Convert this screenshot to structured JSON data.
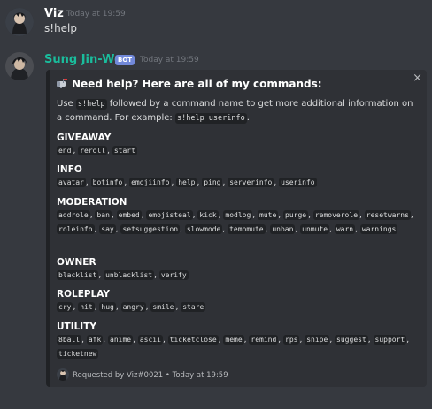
{
  "messages": [
    {
      "author": "Viz",
      "timestamp": "Today at 19:59",
      "content": "s!help"
    },
    {
      "author": "Sung Jin-Woo",
      "author_color": "#1abc9c",
      "bot_tag": "BOT",
      "timestamp": "Today at 19:59"
    }
  ],
  "embed": {
    "close_icon": "×",
    "title": "Need help? Here are all of my commands:",
    "desc_prefix": "Use",
    "desc_code": "s!help",
    "desc_middle": "followed by a command name to get more additional information on a command. For example:",
    "desc_example": "s!help userinfo",
    "desc_suffix": ".",
    "fields": [
      {
        "name": "GIVEAWAY",
        "commands": [
          "end",
          "reroll",
          "start"
        ]
      },
      {
        "name": "INFO",
        "commands": [
          "avatar",
          "botinfo",
          "emojiinfo",
          "help",
          "ping",
          "serverinfo",
          "userinfo"
        ]
      },
      {
        "name": "MODERATION",
        "commands": [
          "addrole",
          "ban",
          "embed",
          "emojisteal",
          "kick",
          "modlog",
          "mute",
          "purge",
          "removerole",
          "resetwarns",
          "roleinfo",
          "say",
          "setsuggestion",
          "slowmode",
          "tempmute",
          "unban",
          "unmute",
          "warn",
          "warnings"
        ]
      },
      {
        "name": "OWNER",
        "commands": [
          "blacklist",
          "unblacklist",
          "verify"
        ]
      },
      {
        "name": "ROLEPLAY",
        "commands": [
          "cry",
          "hit",
          "hug",
          "angry",
          "smile",
          "stare"
        ]
      },
      {
        "name": "UTILITY",
        "commands": [
          "8ball",
          "afk",
          "anime",
          "ascii",
          "ticketclose",
          "meme",
          "remind",
          "rps",
          "snipe",
          "suggest",
          "support",
          "ticketnew"
        ]
      }
    ],
    "footer": "Requested by Viz#0021 • Today at 19:59"
  },
  "icons": {
    "title_emoji": "mailbox-icon",
    "close": "close-icon"
  },
  "colors": {
    "background": "#36393f",
    "embed_bg": "#2f3136",
    "embed_border": "#202225",
    "bot_tag": "#7289da",
    "bot_name": "#1abc9c"
  }
}
